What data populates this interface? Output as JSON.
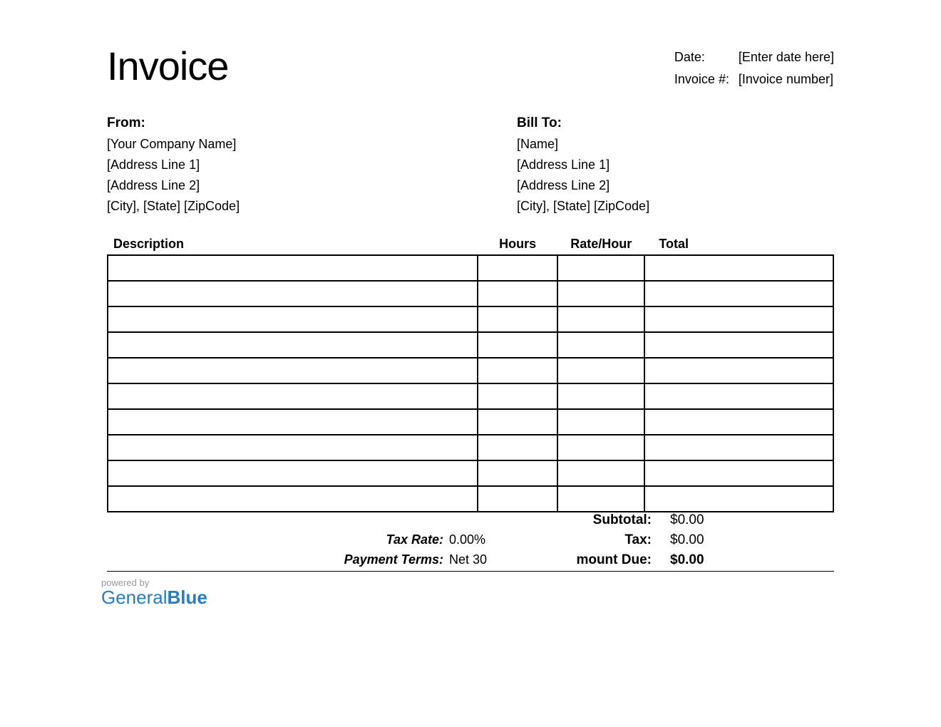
{
  "title": "Invoice",
  "meta": {
    "date_label": "Date:",
    "date_value": "[Enter date here]",
    "invoice_num_label": "Invoice #:",
    "invoice_num_value": "[Invoice number]"
  },
  "from": {
    "heading": "From:",
    "lines": [
      "[Your Company Name]",
      "[Address Line 1]",
      "[Address Line 2]",
      "[City], [State] [ZipCode]"
    ]
  },
  "bill_to": {
    "heading": "Bill To:",
    "lines": [
      "[Name]",
      "[Address Line 1]",
      "[Address Line 2]",
      "[City], [State] [ZipCode]"
    ]
  },
  "columns": {
    "description": "Description",
    "hours": "Hours",
    "rate": "Rate/Hour",
    "total": "Total"
  },
  "rows": [
    {
      "description": "",
      "hours": "",
      "rate": "",
      "total": ""
    },
    {
      "description": "",
      "hours": "",
      "rate": "",
      "total": ""
    },
    {
      "description": "",
      "hours": "",
      "rate": "",
      "total": ""
    },
    {
      "description": "",
      "hours": "",
      "rate": "",
      "total": ""
    },
    {
      "description": "",
      "hours": "",
      "rate": "",
      "total": ""
    },
    {
      "description": "",
      "hours": "",
      "rate": "",
      "total": ""
    },
    {
      "description": "",
      "hours": "",
      "rate": "",
      "total": ""
    },
    {
      "description": "",
      "hours": "",
      "rate": "",
      "total": ""
    },
    {
      "description": "",
      "hours": "",
      "rate": "",
      "total": ""
    },
    {
      "description": "",
      "hours": "",
      "rate": "",
      "total": ""
    }
  ],
  "summary": {
    "subtotal_label": "Subtotal:",
    "subtotal_value": "$0.00",
    "tax_rate_label": "Tax Rate:",
    "tax_rate_value": "0.00%",
    "tax_label": "Tax:",
    "tax_value": "$0.00",
    "payment_terms_label": "Payment Terms:",
    "payment_terms_value": "Net 30",
    "amount_due_label": "mount Due:",
    "amount_due_value": "$0.00"
  },
  "footer": {
    "powered_by": "powered by",
    "brand_part1": "General",
    "brand_part2": "Blue"
  }
}
